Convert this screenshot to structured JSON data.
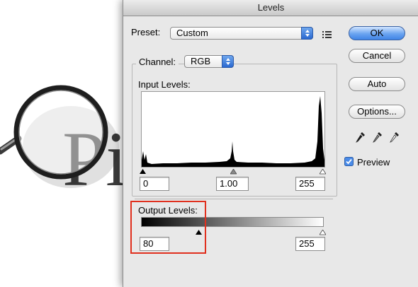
{
  "background": {
    "letters": "Pi",
    "accent_color": "#cc1f28"
  },
  "dialog": {
    "title": "Levels",
    "preset": {
      "label": "Preset:",
      "value": "Custom",
      "menu_icon": "list-options-icon"
    },
    "buttons": {
      "ok": "OK",
      "cancel": "Cancel",
      "auto": "Auto",
      "options": "Options..."
    },
    "eyedroppers": [
      "black-point-eyedropper-icon",
      "gray-point-eyedropper-icon",
      "white-point-eyedropper-icon"
    ],
    "preview": {
      "label": "Preview",
      "checked": true
    },
    "channel": {
      "label": "Channel:",
      "value": "RGB"
    },
    "input_levels": {
      "label": "Input Levels:",
      "black": "0",
      "gamma": "1.00",
      "white": "255"
    },
    "output_levels": {
      "label": "Output Levels:",
      "black": "80",
      "white": "255",
      "black_slider_fraction": 0.314
    },
    "highlight_color": "#e0301e"
  }
}
